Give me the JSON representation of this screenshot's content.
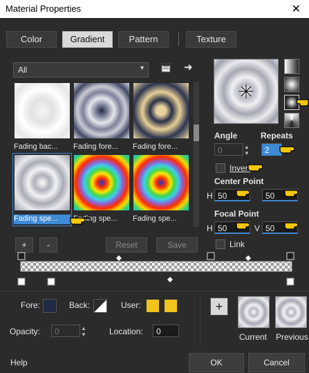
{
  "window": {
    "title": "Material Properties",
    "close_glyph": "✕"
  },
  "tabs": [
    {
      "label": "Color",
      "active": false
    },
    {
      "label": "Gradient",
      "active": true
    },
    {
      "label": "Pattern",
      "active": false
    },
    {
      "label": "Texture",
      "active": false
    }
  ],
  "category": {
    "selected": "All"
  },
  "gallery": [
    {
      "label": "Fading bac...",
      "style": "fade-bg"
    },
    {
      "label": "Fading fore...",
      "style": "fade-fg-dark"
    },
    {
      "label": "Fading fore...",
      "style": "fade-fg-tan"
    },
    {
      "label": "Fading spe...",
      "style": "fade-spec",
      "selected": true
    },
    {
      "label": "Fading spe...",
      "style": "rainbow"
    },
    {
      "label": "Fading spe...",
      "style": "rainbow"
    }
  ],
  "gallery_buttons": {
    "add": "+",
    "remove": "-",
    "reset": "Reset",
    "save": "Save"
  },
  "angle": {
    "label": "Angle",
    "value": "0"
  },
  "repeats": {
    "label": "Repeats",
    "value": "2"
  },
  "invert": {
    "label": "Invert",
    "checked": false
  },
  "center_point": {
    "label": "Center Point",
    "h_label": "H",
    "h": "50",
    "v": "50"
  },
  "focal_point": {
    "label": "Focal Point",
    "h_label": "H",
    "h": "50",
    "v_label": "V",
    "v": "50"
  },
  "link": {
    "label": "Link",
    "checked": false
  },
  "colors": {
    "fore_label": "Fore:",
    "back_label": "Back:",
    "user_label": "User:",
    "user_color_1": "#f0c419",
    "user_color_2": "#f0c419",
    "fore_color": "#1f2a44",
    "accent": "#3d8ad6"
  },
  "opacity": {
    "label": "Opacity:",
    "value": "0"
  },
  "location": {
    "label": "Location:",
    "value": "0"
  },
  "current": {
    "label": "Current"
  },
  "previous": {
    "label": "Previous"
  },
  "footer": {
    "help": "Help",
    "ok": "OK",
    "cancel": "Cancel"
  },
  "icons": {
    "add_swatch": "+",
    "arrow_right": "➜"
  }
}
